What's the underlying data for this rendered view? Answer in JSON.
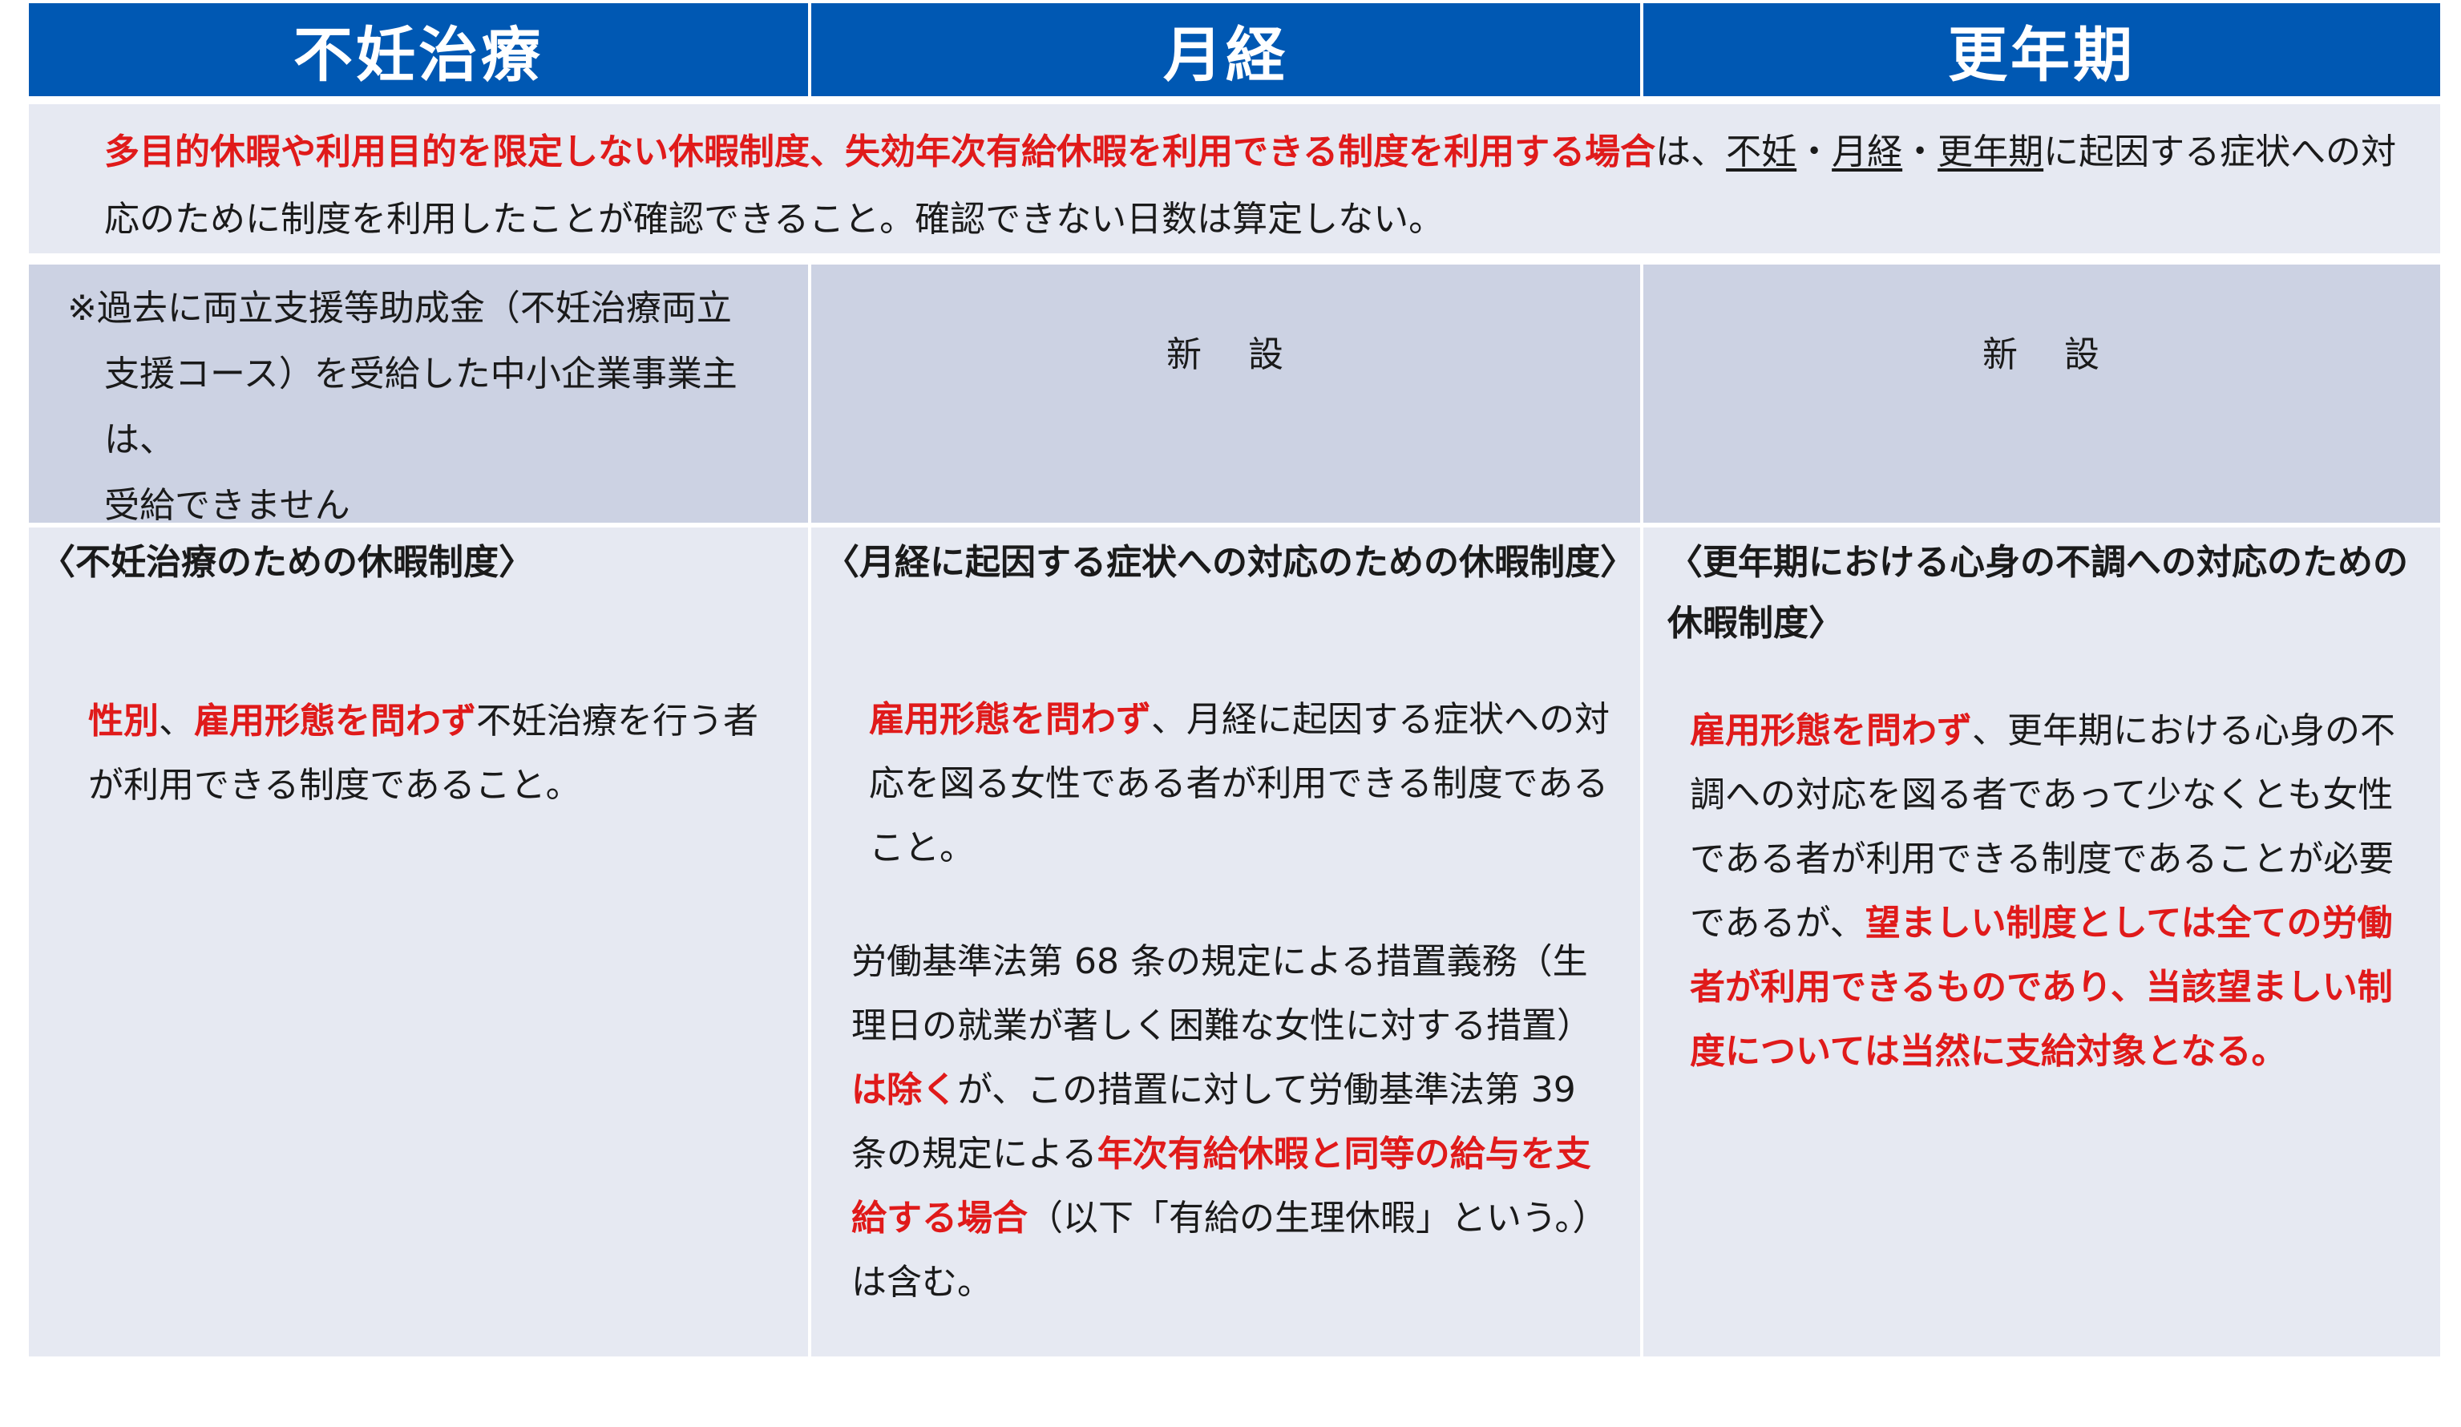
{
  "header": {
    "col1": "不妊治療",
    "col2": "月経",
    "col3": "更年期"
  },
  "banner": {
    "red_text": "多目的休暇や利用目的を限定しない休暇制度、失効年次有給休暇を利用できる制度を利用する場合",
    "text_a": "は、",
    "ul1": "不妊",
    "sep1": "・",
    "ul2": "月経",
    "sep2": "・",
    "ul3": "更年期",
    "text_b": "に起因する症状への対応のために制度を利用したことが確認できること。確認できない日数は算定しない。"
  },
  "note": {
    "col1_line1": "※過去に両立支援等助成金（不妊治療両立",
    "col1_line2": "支援コース）を受給した中小企業事業主は、",
    "col1_line3": "受給できません",
    "col2_a": "新",
    "col2_b": "設",
    "col3_a": "新",
    "col3_b": "設"
  },
  "body": {
    "col1": {
      "heading": "〈不妊治療のための休暇制度〉",
      "red1": "性別",
      "t1": "、",
      "red2": "雇用形態を問わず",
      "t2": "不妊治療を行う者が利用できる制度であること。"
    },
    "col2": {
      "heading": "〈月経に起因する症状への対応のための休暇制度〉",
      "red1": "雇用形態を問わず",
      "t1": "、月経に起因する症状への対応を図る女性である者が利用できる制度であること。",
      "t2": "労働基準法第 68 条の規定による措置義務（生理日の就業が著しく困難な女性に対する措置）",
      "red2": "は除く",
      "t3": "が、この措置に対して労働基準法第 39 条の規定による",
      "red3": "年次有給休暇と同等の給与を支給する場合",
      "t4": "（以下「有給の生理休暇」という。）は含む。"
    },
    "col3": {
      "heading": "〈更年期における心身の不調への対応のための休暇制度〉",
      "red1": "雇用形態を問わず",
      "t1": "、更年期における心身の不調への対応を図る者であって少なくとも女性である者が利用できる制度であることが必要であるが、",
      "red2": "望ましい制度としては全ての労働者が利用できるものであり、当該望ましい制度については当然に支給対象となる。"
    }
  },
  "colors": {
    "header_bg": "#0058b3",
    "light_bg": "#e6e9f2",
    "note_bg": "#ccd2e3",
    "emphasis": "#e01a1a"
  }
}
